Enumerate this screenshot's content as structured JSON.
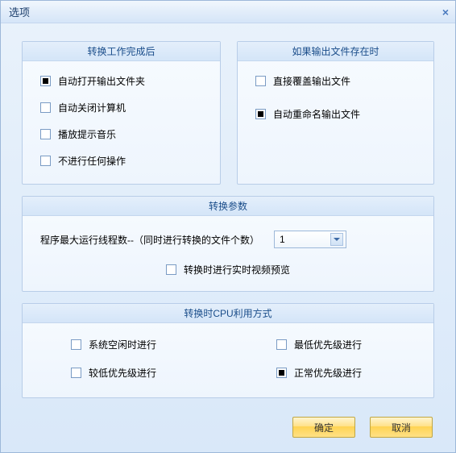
{
  "window": {
    "title": "选项"
  },
  "group_after": {
    "title": "转换工作完成后",
    "opts": [
      {
        "label": "自动打开输出文件夹",
        "checked": true
      },
      {
        "label": "自动关闭计算机",
        "checked": false
      },
      {
        "label": "播放提示音乐",
        "checked": false
      },
      {
        "label": "不进行任何操作",
        "checked": false
      }
    ]
  },
  "group_exists": {
    "title": "如果输出文件存在时",
    "opts": [
      {
        "label": "直接覆盖输出文件",
        "checked": false
      },
      {
        "label": "自动重命名输出文件",
        "checked": true
      }
    ]
  },
  "group_params": {
    "title": "转换参数",
    "threads_label": "程序最大运行线程数--（同时进行转换的文件个数）",
    "threads_value": "1",
    "preview_label": "转换时进行实时视频预览",
    "preview_checked": false
  },
  "group_cpu": {
    "title": "转换时CPU利用方式",
    "left": [
      {
        "label": "系统空闲时进行",
        "checked": false
      },
      {
        "label": "较低优先级进行",
        "checked": false
      }
    ],
    "right": [
      {
        "label": "最低优先级进行",
        "checked": false
      },
      {
        "label": "正常优先级进行",
        "checked": true
      }
    ]
  },
  "buttons": {
    "ok": "确定",
    "cancel": "取消"
  }
}
